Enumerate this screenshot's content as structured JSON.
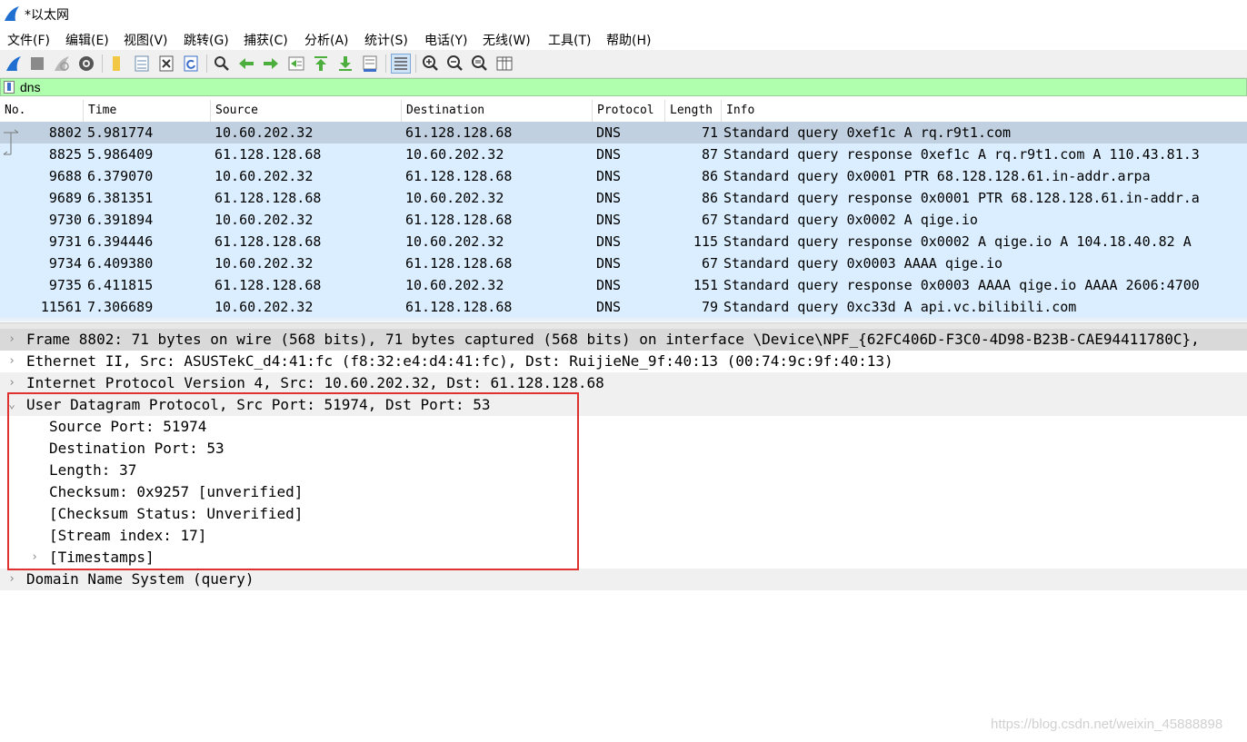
{
  "window": {
    "title": "*以太网"
  },
  "menu": [
    "文件(F)",
    "编辑(E)",
    "视图(V)",
    "跳转(G)",
    "捕获(C)",
    "分析(A)",
    "统计(S)",
    "电话(Y)",
    "无线(W)",
    "工具(T)",
    "帮助(H)"
  ],
  "toolbar": [
    "start-capture-icon",
    "stop-capture-icon",
    "restart-capture-icon",
    "capture-options-icon",
    "open-file-icon",
    "save-file-icon",
    "close-file-icon",
    "reload-file-icon",
    "find-packet-icon",
    "go-back-icon",
    "go-forward-icon",
    "go-to-packet-icon",
    "first-packet-icon",
    "last-packet-icon",
    "autoscroll-icon",
    "colorize-icon",
    "zoom-in-icon",
    "zoom-out-icon",
    "normal-size-icon",
    "resize-columns-icon"
  ],
  "filter": {
    "value": "dns"
  },
  "packet_list": {
    "columns": [
      "No.",
      "Time",
      "Source",
      "Destination",
      "Protocol",
      "Length",
      "Info"
    ],
    "rows": [
      {
        "no": "8802",
        "time": "5.981774",
        "src": "10.60.202.32",
        "dst": "61.128.128.68",
        "proto": "DNS",
        "len": "71",
        "info": "Standard query 0xef1c A rq.r9t1.com",
        "selected": true
      },
      {
        "no": "8825",
        "time": "5.986409",
        "src": "61.128.128.68",
        "dst": "10.60.202.32",
        "proto": "DNS",
        "len": "87",
        "info": "Standard query response 0xef1c A rq.r9t1.com A 110.43.81.3"
      },
      {
        "no": "9688",
        "time": "6.379070",
        "src": "10.60.202.32",
        "dst": "61.128.128.68",
        "proto": "DNS",
        "len": "86",
        "info": "Standard query 0x0001 PTR 68.128.128.61.in-addr.arpa"
      },
      {
        "no": "9689",
        "time": "6.381351",
        "src": "61.128.128.68",
        "dst": "10.60.202.32",
        "proto": "DNS",
        "len": "86",
        "info": "Standard query response 0x0001 PTR 68.128.128.61.in-addr.a"
      },
      {
        "no": "9730",
        "time": "6.391894",
        "src": "10.60.202.32",
        "dst": "61.128.128.68",
        "proto": "DNS",
        "len": "67",
        "info": "Standard query 0x0002 A qige.io"
      },
      {
        "no": "9731",
        "time": "6.394446",
        "src": "61.128.128.68",
        "dst": "10.60.202.32",
        "proto": "DNS",
        "len": "115",
        "info": "Standard query response 0x0002 A qige.io A 104.18.40.82 A"
      },
      {
        "no": "9734",
        "time": "6.409380",
        "src": "10.60.202.32",
        "dst": "61.128.128.68",
        "proto": "DNS",
        "len": "67",
        "info": "Standard query 0x0003 AAAA qige.io"
      },
      {
        "no": "9735",
        "time": "6.411815",
        "src": "61.128.128.68",
        "dst": "10.60.202.32",
        "proto": "DNS",
        "len": "151",
        "info": "Standard query response 0x0003 AAAA qige.io AAAA 2606:4700"
      },
      {
        "no": "11561",
        "time": "7.306689",
        "src": "10.60.202.32",
        "dst": "61.128.128.68",
        "proto": "DNS",
        "len": "79",
        "info": "Standard query 0xc33d A api.vc.bilibili.com"
      }
    ]
  },
  "details": [
    {
      "text": "Frame 8802: 71 bytes on wire (568 bits), 71 bytes captured (568 bits) on interface \\Device\\NPF_{62FC406D-F3C0-4D98-B23B-CAE94411780C},",
      "indent": 0,
      "arrow": "›",
      "style": "sel"
    },
    {
      "text": "Ethernet II, Src: ASUSTekC_d4:41:fc (f8:32:e4:d4:41:fc), Dst: RuijieNe_9f:40:13 (00:74:9c:9f:40:13)",
      "indent": 0,
      "arrow": "›",
      "style": ""
    },
    {
      "text": "Internet Protocol Version 4, Src: 10.60.202.32, Dst: 61.128.128.68",
      "indent": 0,
      "arrow": "›",
      "style": "shade"
    },
    {
      "text": "User Datagram Protocol, Src Port: 51974, Dst Port: 53",
      "indent": 0,
      "arrow": "⌄",
      "style": "shade"
    },
    {
      "text": "Source Port: 51974",
      "indent": 1,
      "arrow": "",
      "style": ""
    },
    {
      "text": "Destination Port: 53",
      "indent": 1,
      "arrow": "",
      "style": ""
    },
    {
      "text": "Length: 37",
      "indent": 1,
      "arrow": "",
      "style": ""
    },
    {
      "text": "Checksum: 0x9257 [unverified]",
      "indent": 1,
      "arrow": "",
      "style": ""
    },
    {
      "text": "[Checksum Status: Unverified]",
      "indent": 1,
      "arrow": "",
      "style": ""
    },
    {
      "text": "[Stream index: 17]",
      "indent": 1,
      "arrow": "",
      "style": ""
    },
    {
      "text": "[Timestamps]",
      "indent": 1,
      "arrow": "›",
      "style": ""
    },
    {
      "text": "Domain Name System (query)",
      "indent": 0,
      "arrow": "›",
      "style": "shade"
    }
  ],
  "watermark": "https://blog.csdn.net/weixin_45888898"
}
